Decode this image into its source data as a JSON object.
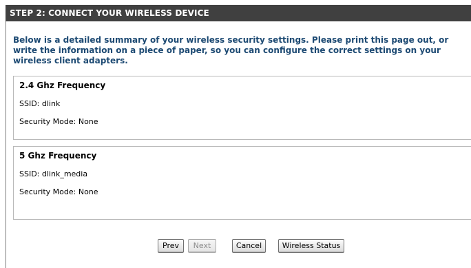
{
  "header": {
    "title": "STEP 2: CONNECT YOUR WIRELESS DEVICE"
  },
  "intro": {
    "text": "Below is a detailed summary of your wireless security settings. Please print this page out, or write the information on a piece of paper, so you can configure the correct settings on your wireless client adapters."
  },
  "bands": [
    {
      "title": "2.4 Ghz Frequency",
      "ssid": "SSID: dlink",
      "security": "Security Mode: None"
    },
    {
      "title": "5 Ghz Frequency",
      "ssid": "SSID: dlink_media",
      "security": "Security Mode: None"
    }
  ],
  "buttons": {
    "prev": "Prev",
    "next": "Next",
    "cancel": "Cancel",
    "status": "Wireless Status"
  },
  "colors": {
    "titlebar": "#404040",
    "intro_text": "#1d4a73"
  }
}
